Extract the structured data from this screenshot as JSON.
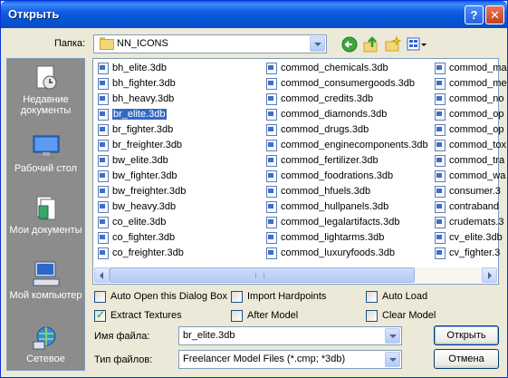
{
  "window": {
    "title": "Открыть",
    "help_label": "?",
    "close_label": "✕"
  },
  "lookin": {
    "label": "Папка:",
    "value": "NN_ICONS"
  },
  "places": [
    {
      "name": "recent",
      "label": "Недавние документы"
    },
    {
      "name": "desktop",
      "label": "Рабочий стол"
    },
    {
      "name": "mydocs",
      "label": "Мои документы"
    },
    {
      "name": "mycomputer",
      "label": "Мой компьютер"
    },
    {
      "name": "network",
      "label": "Сетевое"
    }
  ],
  "files": {
    "col1": [
      "bh_elite.3db",
      "bh_fighter.3db",
      "bh_heavy.3db",
      "br_elite.3db",
      "br_fighter.3db",
      "br_freighter.3db",
      "bw_elite.3db",
      "bw_fighter.3db",
      "bw_freighter.3db",
      "bw_heavy.3db",
      "co_elite.3db",
      "co_fighter.3db",
      "co_freighter.3db"
    ],
    "col2": [
      "commod_chemicals.3db",
      "commod_consumergoods.3db",
      "commod_credits.3db",
      "commod_diamonds.3db",
      "commod_drugs.3db",
      "commod_enginecomponents.3db",
      "commod_fertilizer.3db",
      "commod_foodrations.3db",
      "commod_hfuels.3db",
      "commod_hullpanels.3db",
      "commod_legalartifacts.3db",
      "commod_lightarms.3db",
      "commod_luxuryfoods.3db"
    ],
    "col3": [
      "commod_ma",
      "commod_me",
      "commod_no",
      "commod_op",
      "commod_op",
      "commod_tox",
      "commod_tra",
      "commod_wa",
      "consumer.3",
      "contraband",
      "crudemats.3",
      "cv_elite.3db",
      "cv_fighter.3"
    ],
    "selected": "br_elite.3db"
  },
  "options": {
    "auto_open": {
      "label": "Auto Open this Dialog Box",
      "checked": false
    },
    "import_hardpoints": {
      "label": "Import Hardpoints",
      "checked": false
    },
    "auto_load": {
      "label": "Auto Load",
      "checked": false
    },
    "extract_textures": {
      "label": "Extract Textures",
      "checked": true
    },
    "after_model": {
      "label": "After Model",
      "checked": false
    },
    "clear_model": {
      "label": "Clear Model",
      "checked": false
    }
  },
  "filename": {
    "label": "Имя файла:",
    "value": "br_elite.3db"
  },
  "filetype": {
    "label": "Тип файлов:",
    "value": "Freelancer Model Files (*.cmp; *3db)"
  },
  "buttons": {
    "open": "Открыть",
    "cancel": "Отмена"
  }
}
